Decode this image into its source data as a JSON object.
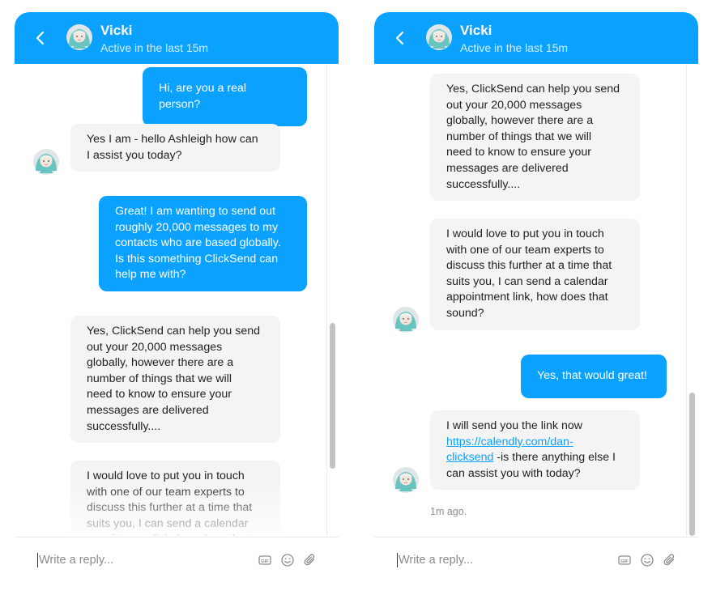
{
  "header": {
    "name": "Vicki",
    "status": "Active in the last 15m"
  },
  "composer": {
    "placeholder": "Write a reply...",
    "icons": [
      "gif-icon",
      "emoji-icon",
      "attachment-icon"
    ]
  },
  "colors": {
    "accent": "#0aa1ff",
    "bot_bubble": "#f4f4f4"
  },
  "left": {
    "messages": [
      {
        "from": "user",
        "text": "Hi, are you a real person?"
      },
      {
        "from": "bot",
        "text": "Yes I am - hello Ashleigh how can\nI assist you today?"
      },
      {
        "from": "user",
        "text": "Great! I am wanting to send out\nroughly 20,000 messages to my\ncontacts who are based globally.\nIs this something ClickSend can\nhelp me with?"
      },
      {
        "from": "bot",
        "text": "Yes, ClickSend can help you send\nout your 20,000 messages\nglobally, however there are a\nnumber of things that we will\nneed to know to ensure your\nmessages are delivered\nsuccessfully...."
      },
      {
        "from": "bot",
        "text": "I would love to put you in touch\nwith one of our team experts to\ndiscuss this further at a time that\nsuits you, I can send a calendar\nappointment link, how does that\nsound?"
      }
    ]
  },
  "right": {
    "messages": [
      {
        "from": "bot",
        "text": "Yes, ClickSend can help you send\nout your 20,000 messages\nglobally, however there are a\nnumber of things that we will\nneed to know to ensure your\nmessages are delivered\nsuccessfully...."
      },
      {
        "from": "bot",
        "text": "I would love to put you in touch\nwith one of our team experts to\ndiscuss this further at a time that\nsuits you, I can send a calendar\nappointment link, how does that\nsound?"
      },
      {
        "from": "user",
        "text": "Yes, that would great!"
      },
      {
        "from": "bot",
        "text_before": "I will send you the link now",
        "link_line1": "https://calendly.com/dan-",
        "link_line2": "clicksend",
        "text_after": " -is there anything else I",
        "text_end": "can assist you with today?"
      }
    ],
    "timestamp": "1m ago."
  }
}
